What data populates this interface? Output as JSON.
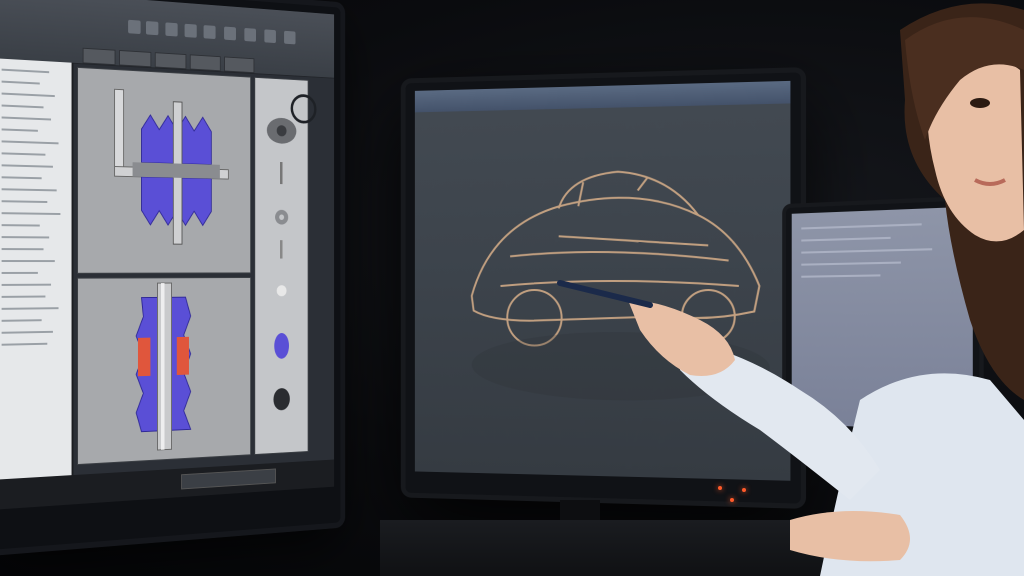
{
  "scene": {
    "palette": {
      "background": "#07080b",
      "cad_blue": "#5a4fd6",
      "cad_red": "#e0563c",
      "car_wire": "#d9b08a",
      "led_orange": "#ff5a2a",
      "ribbon_accent": "#d8c35a"
    },
    "icons": [
      "cube-viewcube-icon",
      "stylus-icon"
    ]
  }
}
